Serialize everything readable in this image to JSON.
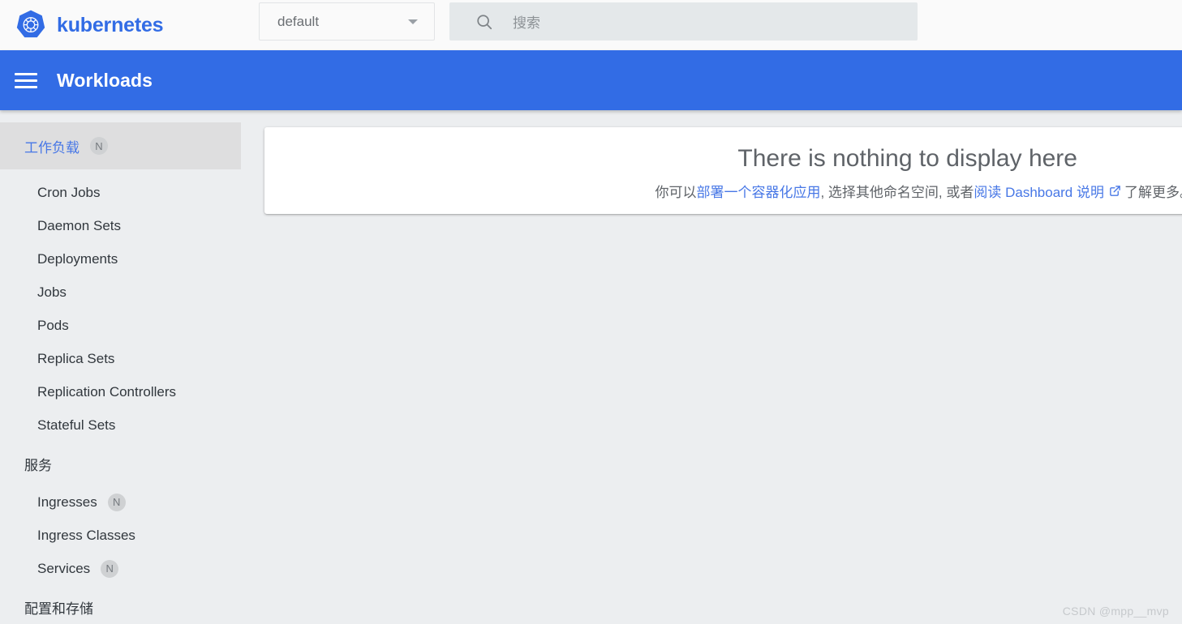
{
  "toolbar": {
    "brand_name": "kubernetes",
    "brand_color": "#326ce5",
    "logo_icon": "kubernetes-helm-wheel-icon",
    "namespace": {
      "selected": "default",
      "caret_icon": "chevron-down-icon"
    },
    "search": {
      "icon": "search-icon",
      "placeholder": "搜索",
      "value": ""
    }
  },
  "appbar": {
    "menu_icon": "hamburger-menu-icon",
    "title": "Workloads",
    "background": "#326ce5"
  },
  "sidebar": {
    "items": [
      {
        "label": "工作负载",
        "badge": "N",
        "active": true,
        "type": "section-link"
      },
      {
        "label": "Cron Jobs",
        "badge": "",
        "active": false,
        "type": "link"
      },
      {
        "label": "Daemon Sets",
        "badge": "",
        "active": false,
        "type": "link"
      },
      {
        "label": "Deployments",
        "badge": "",
        "active": false,
        "type": "link"
      },
      {
        "label": "Jobs",
        "badge": "",
        "active": false,
        "type": "link"
      },
      {
        "label": "Pods",
        "badge": "",
        "active": false,
        "type": "link"
      },
      {
        "label": "Replica Sets",
        "badge": "",
        "active": false,
        "type": "link"
      },
      {
        "label": "Replication Controllers",
        "badge": "",
        "active": false,
        "type": "link"
      },
      {
        "label": "Stateful Sets",
        "badge": "",
        "active": false,
        "type": "link"
      },
      {
        "label": "服务",
        "badge": "",
        "active": false,
        "type": "header"
      },
      {
        "label": "Ingresses",
        "badge": "N",
        "active": false,
        "type": "link"
      },
      {
        "label": "Ingress Classes",
        "badge": "",
        "active": false,
        "type": "link"
      },
      {
        "label": "Services",
        "badge": "N",
        "active": false,
        "type": "link"
      },
      {
        "label": "配置和存储",
        "badge": "",
        "active": false,
        "type": "header"
      }
    ]
  },
  "main": {
    "empty_state": {
      "title": "There is nothing to display here",
      "sub_prefix": "你可以 ",
      "link1": "部署一个容器化应用",
      "sub_middle": ", 选择其他命名空间, 或者 ",
      "link2": "阅读 Dashboard 说明",
      "ext_icon": "external-link-icon",
      "sub_suffix": " 了解更多。",
      "link_color": "#4777e6"
    }
  },
  "watermark": {
    "text": "CSDN @mpp__mvp"
  }
}
